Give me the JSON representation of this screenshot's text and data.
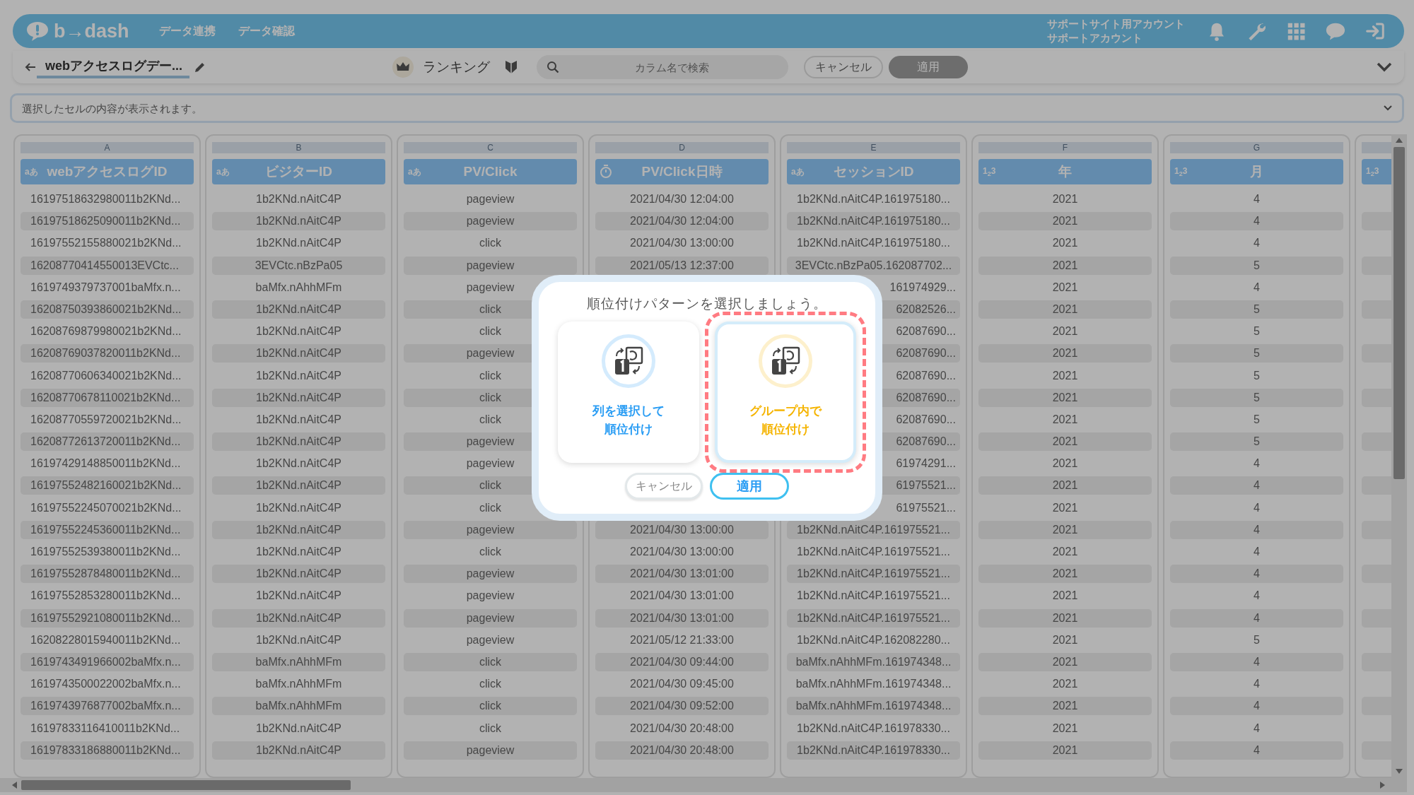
{
  "header": {
    "logo": "b→dash",
    "nav": [
      {
        "label": "データ連携"
      },
      {
        "label": "データ確認"
      }
    ],
    "account_lines": [
      "サポートサイト用アカウント",
      "サポートアカウント"
    ]
  },
  "toolbar": {
    "title": "webアクセスログデー...",
    "mode": "ランキング",
    "search": {
      "placeholder": "カラム名で検索"
    },
    "buttons": [
      {
        "label": "キャンセル",
        "disabled": false
      },
      {
        "label": "適用",
        "disabled": true
      }
    ]
  },
  "cell_bar": {
    "placeholder": "選択したセルの内容が表示されます。"
  },
  "table": {
    "columns": [
      {
        "letter": "A",
        "kind": "text",
        "type_label": "aあ",
        "title": "webアクセスログID"
      },
      {
        "letter": "B",
        "kind": "text",
        "type_label": "aあ",
        "title": "ビジターID"
      },
      {
        "letter": "C",
        "kind": "text",
        "type_label": "aあ",
        "title": "PV/Click"
      },
      {
        "letter": "D",
        "kind": "datetime",
        "title": "PV/Click日時"
      },
      {
        "letter": "E",
        "kind": "text",
        "type_label": "aあ",
        "title": "セッションID"
      },
      {
        "letter": "F",
        "kind": "number",
        "type_label": "1$_{2}$3",
        "title": "年"
      },
      {
        "letter": "G",
        "kind": "number",
        "type_label": "1$_{2}$3",
        "title": "月"
      },
      {
        "kind": "number",
        "type_label": "1$_{2}$3"
      }
    ],
    "rows": [
      [
        "16197518632980011b2KNd...",
        "1b2KNd.nAitC4P",
        "pageview",
        "2021/04/30 12:04:00",
        "1b2KNd.nAitC4P.161975180...",
        "2021",
        "4"
      ],
      [
        "16197518625090011b2KNd...",
        "1b2KNd.nAitC4P",
        "pageview",
        "2021/04/30 12:04:00",
        "1b2KNd.nAitC4P.161975180...",
        "2021",
        "4"
      ],
      [
        "16197552155880021b2KNd...",
        "1b2KNd.nAitC4P",
        "click",
        "2021/04/30 13:00:00",
        "1b2KNd.nAitC4P.161975180...",
        "2021",
        "4"
      ],
      [
        "16208770414550013EVCtc...",
        "3EVCtc.nBzPa05",
        "pageview",
        "2021/05/13 12:37:00",
        "3EVCtc.nBzPa05.162087702...",
        "2021",
        "5"
      ],
      [
        "1619749379737001baMfx.n...",
        "baMfx.nAhhMFm",
        "pageview",
        null,
        "161974929...",
        "2021",
        "4"
      ],
      [
        "16208750393860021b2KNd...",
        "1b2KNd.nAitC4P",
        "click",
        null,
        "62082526...",
        "2021",
        "5"
      ],
      [
        "16208769879980021b2KNd...",
        "1b2KNd.nAitC4P",
        "click",
        null,
        "62087690...",
        "2021",
        "5"
      ],
      [
        "16208769037820011b2KNd...",
        "1b2KNd.nAitC4P",
        "pageview",
        null,
        "62087690...",
        "2021",
        "5"
      ],
      [
        "16208770606340021b2KNd...",
        "1b2KNd.nAitC4P",
        "click",
        null,
        "62087690...",
        "2021",
        "5"
      ],
      [
        "16208770678110021b2KNd...",
        "1b2KNd.nAitC4P",
        "click",
        null,
        "62087690...",
        "2021",
        "5"
      ],
      [
        "16208770559720021b2KNd...",
        "1b2KNd.nAitC4P",
        "click",
        null,
        "62087690...",
        "2021",
        "5"
      ],
      [
        "16208772613720011b2KNd...",
        "1b2KNd.nAitC4P",
        "pageview",
        null,
        "62087690...",
        "2021",
        "5"
      ],
      [
        "16197429148850011b2KNd...",
        "1b2KNd.nAitC4P",
        "pageview",
        null,
        "61974291...",
        "2021",
        "4"
      ],
      [
        "16197552482160021b2KNd...",
        "1b2KNd.nAitC4P",
        "click",
        null,
        "61975521...",
        "2021",
        "4"
      ],
      [
        "16197552245070021b2KNd...",
        "1b2KNd.nAitC4P",
        "click",
        null,
        "61975521...",
        "2021",
        "4"
      ],
      [
        "16197552245360011b2KNd...",
        "1b2KNd.nAitC4P",
        "pageview",
        "2021/04/30 13:00:00",
        "1b2KNd.nAitC4P.161975521...",
        "2021",
        "4"
      ],
      [
        "16197552539380011b2KNd...",
        "1b2KNd.nAitC4P",
        "click",
        "2021/04/30 13:00:00",
        "1b2KNd.nAitC4P.161975521...",
        "2021",
        "4"
      ],
      [
        "16197552878480011b2KNd...",
        "1b2KNd.nAitC4P",
        "pageview",
        "2021/04/30 13:01:00",
        "1b2KNd.nAitC4P.161975521...",
        "2021",
        "4"
      ],
      [
        "16197552853280011b2KNd...",
        "1b2KNd.nAitC4P",
        "pageview",
        "2021/04/30 13:01:00",
        "1b2KNd.nAitC4P.161975521...",
        "2021",
        "4"
      ],
      [
        "16197552921080011b2KNd...",
        "1b2KNd.nAitC4P",
        "pageview",
        "2021/04/30 13:01:00",
        "1b2KNd.nAitC4P.161975521...",
        "2021",
        "4"
      ],
      [
        "16208228015940011b2KNd...",
        "1b2KNd.nAitC4P",
        "pageview",
        "2021/05/12 21:33:00",
        "1b2KNd.nAitC4P.162082280...",
        "2021",
        "5"
      ],
      [
        "1619743491966002baMfx.n...",
        "baMfx.nAhhMFm",
        "click",
        "2021/04/30 09:44:00",
        "baMfx.nAhhMFm.161974348...",
        "2021",
        "4"
      ],
      [
        "1619743500022002baMfx.n...",
        "baMfx.nAhhMFm",
        "click",
        "2021/04/30 09:45:00",
        "baMfx.nAhhMFm.161974348...",
        "2021",
        "4"
      ],
      [
        "1619743976877002baMfx.n...",
        "baMfx.nAhhMFm",
        "click",
        "2021/04/30 09:52:00",
        "baMfx.nAhhMFm.161974348...",
        "2021",
        "4"
      ],
      [
        "16197833116410011b2KNd...",
        "1b2KNd.nAitC4P",
        "click",
        "2021/04/30 20:48:00",
        "1b2KNd.nAitC4P.161978330...",
        "2021",
        "4"
      ],
      [
        "16197833186880011b2KNd...",
        "1b2KNd.nAitC4P",
        "pageview",
        "2021/04/30 20:48:00",
        "1b2KNd.nAitC4P.161978330...",
        "2021",
        "4"
      ]
    ]
  },
  "dialog": {
    "title": "順位付けパターンを選択しましょう。",
    "options": [
      {
        "label": "列を選択して順位付け",
        "color": "#2a9df4",
        "selected": false,
        "highlighted": false
      },
      {
        "label": "グループ内で順位付け",
        "color": "#f5b400",
        "selected": true,
        "highlighted": true
      }
    ],
    "buttons": [
      {
        "label": "キャンセル",
        "kind": "secondary"
      },
      {
        "label": "適用",
        "kind": "primary"
      }
    ]
  }
}
